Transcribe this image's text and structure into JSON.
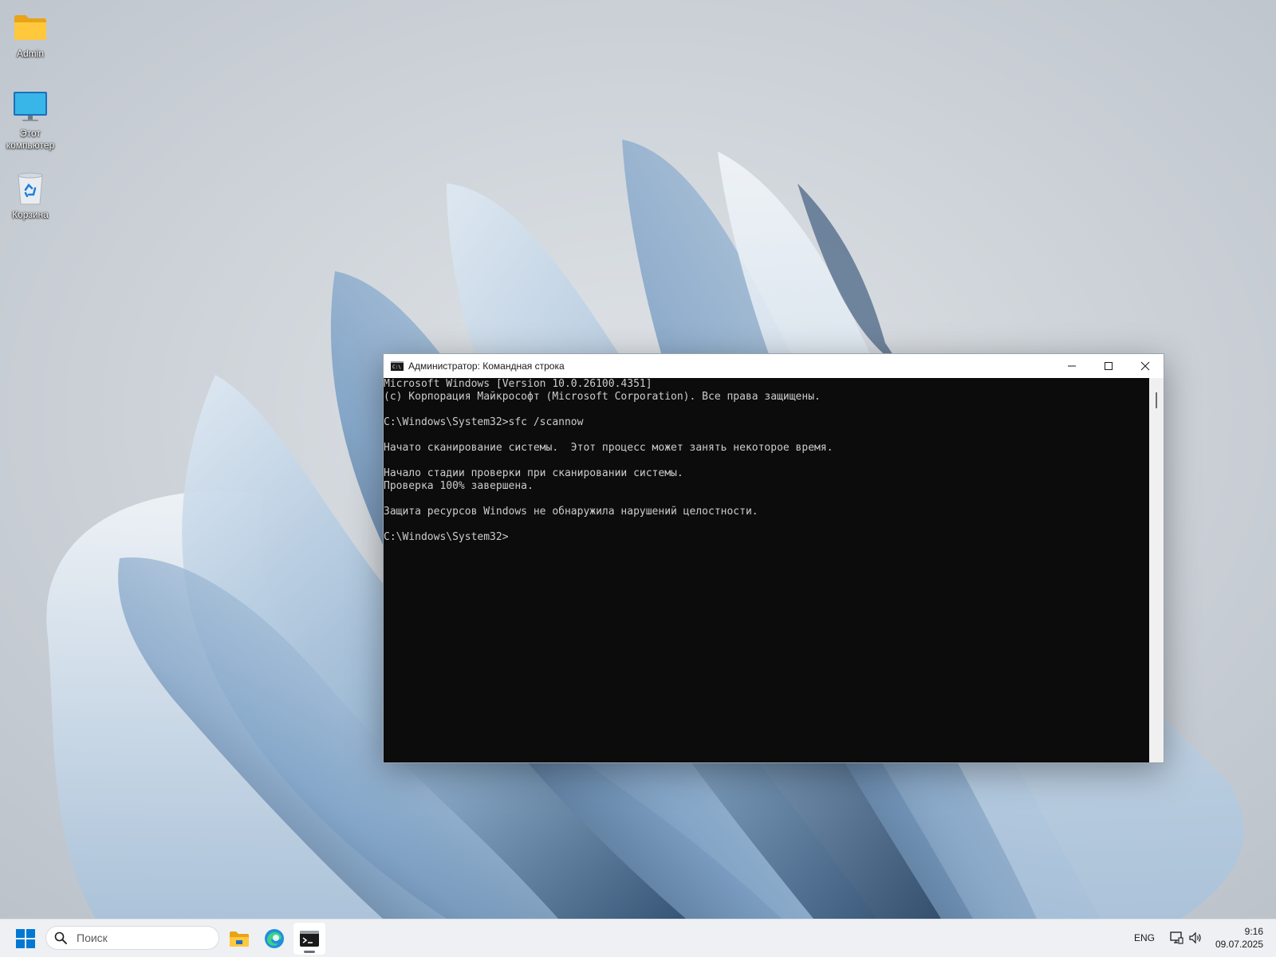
{
  "desktop": {
    "icons": [
      {
        "label": "Admin",
        "icon": "folder-icon"
      },
      {
        "label": "Этот компьютер",
        "icon": "computer-icon"
      },
      {
        "label": "Корзина",
        "icon": "recycle-bin-icon"
      }
    ]
  },
  "window": {
    "title": "Администратор: Командная строка",
    "icon": "cmd-icon",
    "buttons": {
      "minimize": "minimize-icon",
      "maximize": "maximize-icon",
      "close": "close-icon"
    },
    "console_lines": [
      "Microsoft Windows [Version 10.0.26100.4351]",
      "(c) Корпорация Майкрософт (Microsoft Corporation). Все права защищены.",
      "",
      "C:\\Windows\\System32>sfc /scannow",
      "",
      "Начато сканирование системы.  Этот процесс может занять некоторое время.",
      "",
      "Начало стадии проверки при сканировании системы.",
      "Проверка 100% завершена.",
      "",
      "Защита ресурсов Windows не обнаружила нарушений целостности.",
      "",
      "C:\\Windows\\System32>"
    ]
  },
  "taskbar": {
    "search": {
      "placeholder": "Поиск"
    },
    "apps": [
      "file-explorer-icon",
      "edge-icon",
      "cmd-icon"
    ],
    "tray": {
      "language": "ENG",
      "time": "9:16",
      "date": "09.07.2025"
    }
  },
  "colors": {
    "console_bg": "#0c0c0c",
    "console_fg": "#cccccc",
    "accent": "#0078d4"
  }
}
